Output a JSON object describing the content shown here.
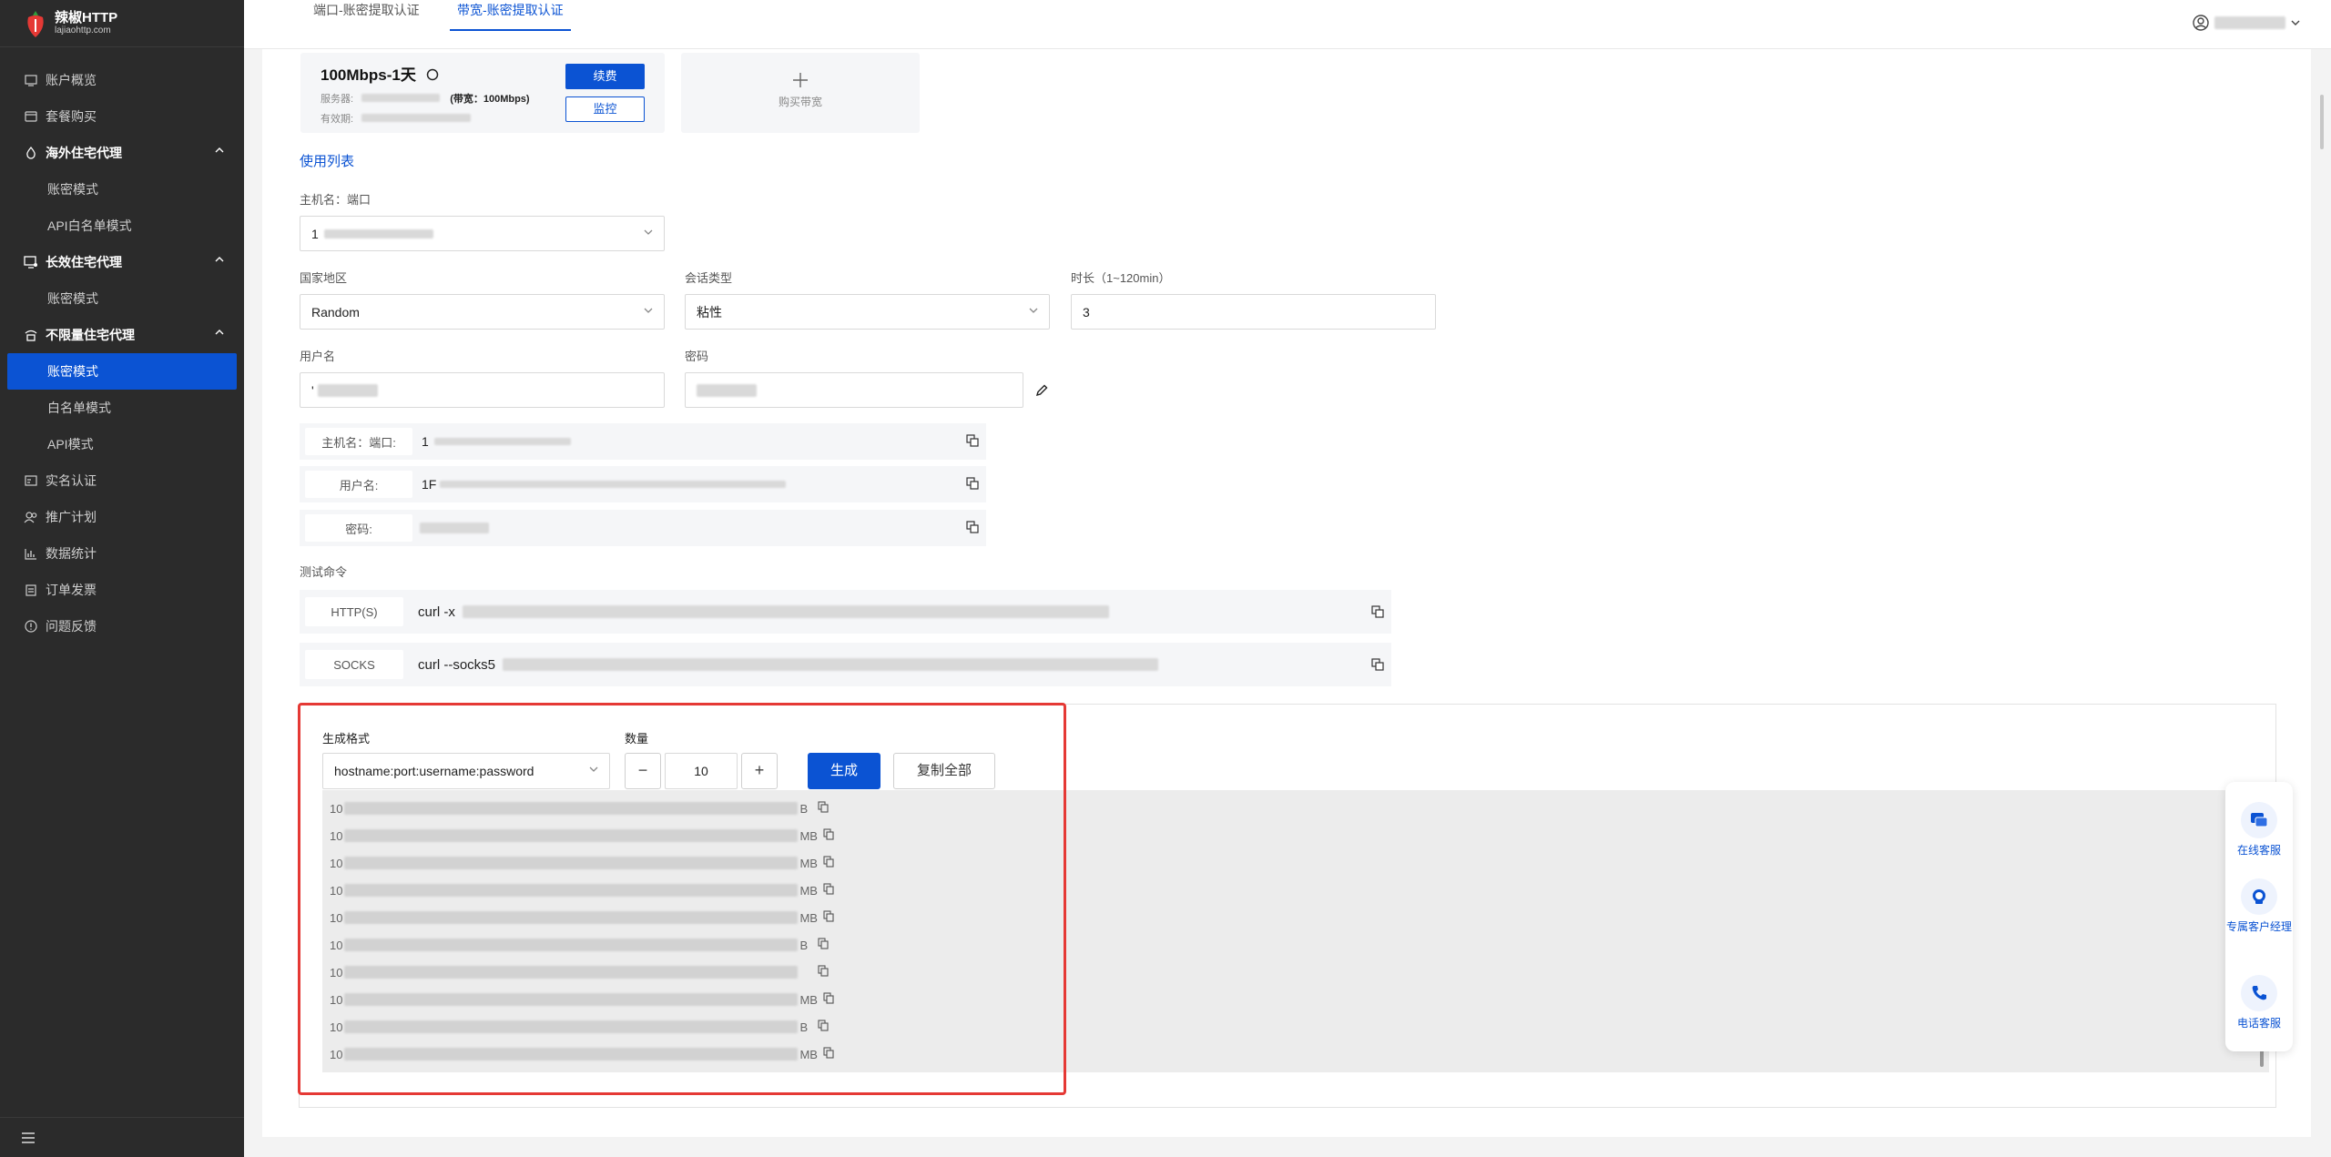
{
  "brand": {
    "name": "辣椒HTTP",
    "domain": "lajiaohttp.com"
  },
  "sidebar": {
    "items": [
      {
        "label": "账户概览",
        "type": "item",
        "icon": "monitor-icon"
      },
      {
        "label": "套餐购买",
        "type": "item",
        "icon": "wallet-icon"
      },
      {
        "label": "海外住宅代理",
        "type": "group",
        "icon": "drop-icon"
      },
      {
        "label": "账密模式",
        "type": "sub"
      },
      {
        "label": "API白名单模式",
        "type": "sub"
      },
      {
        "label": "长效住宅代理",
        "type": "group",
        "icon": "desktop-icon"
      },
      {
        "label": "账密模式",
        "type": "sub"
      },
      {
        "label": "不限量住宅代理",
        "type": "group",
        "icon": "signal-home-icon"
      },
      {
        "label": "账密模式",
        "type": "sub",
        "active": true
      },
      {
        "label": "白名单模式",
        "type": "sub"
      },
      {
        "label": "API模式",
        "type": "sub"
      },
      {
        "label": "实名认证",
        "type": "item",
        "icon": "id-card-icon"
      },
      {
        "label": "推广计划",
        "type": "item",
        "icon": "people-icon"
      },
      {
        "label": "数据统计",
        "type": "item",
        "icon": "bar-chart-icon"
      },
      {
        "label": "订单发票",
        "type": "item",
        "icon": "clipboard-icon"
      },
      {
        "label": "问题反馈",
        "type": "item",
        "icon": "alert-circle-icon"
      }
    ]
  },
  "tabs": [
    {
      "label": "端口-账密提取认证",
      "active": false
    },
    {
      "label": "带宽-账密提取认证",
      "active": true
    }
  ],
  "order": {
    "title": "100Mbps-1天",
    "server_label": "服务器:",
    "bandwidth_text": "(带宽：100Mbps)",
    "expiry_label": "有效期:",
    "renew_label": "续费",
    "monitor_label": "监控",
    "buy_label": "购买带宽"
  },
  "usage_list_title": "使用列表",
  "form": {
    "host_port_label": "主机名：端口",
    "host_port_value": "1",
    "country_label": "国家地区",
    "country_value": "Random",
    "session_label": "会话类型",
    "session_value": "粘性",
    "duration_label": "时长（1~120min）",
    "duration_value": "3",
    "username_label": "用户名",
    "username_value": "'",
    "password_label": "密码"
  },
  "info": {
    "host_key": "主机名：端口:",
    "host_value": "1",
    "user_key": "用户名:",
    "user_value": "1F",
    "pass_key": "密码:"
  },
  "test_cmd": {
    "title": "测试命令",
    "http_key": "HTTP(S)",
    "http_value": "curl -x",
    "socks_key": "SOCKS",
    "socks_value": "curl --socks5"
  },
  "generator": {
    "format_label": "生成格式",
    "format_value": "hostname:port:username:password",
    "qty_label": "数量",
    "qty_value": "10",
    "minus": "−",
    "plus": "+",
    "generate_label": "生成",
    "copy_all_label": "复制全部",
    "results": [
      {
        "prefix": "10",
        "suffix": "B"
      },
      {
        "prefix": "10",
        "suffix": "MB"
      },
      {
        "prefix": "10",
        "suffix": "MB"
      },
      {
        "prefix": "10",
        "suffix": "MB"
      },
      {
        "prefix": "10",
        "suffix": "MB"
      },
      {
        "prefix": "10",
        "suffix": "B"
      },
      {
        "prefix": "10",
        "suffix": ""
      },
      {
        "prefix": "10",
        "suffix": "MB"
      },
      {
        "prefix": "10",
        "suffix": "B"
      },
      {
        "prefix": "10",
        "suffix": "MB"
      }
    ]
  },
  "service": {
    "online": "在线客服",
    "manager": "专属客户经理",
    "phone": "电话客服"
  },
  "colors": {
    "accent": "#0b53d3",
    "sidebar": "#2b2b2b",
    "highlight": "#e53935"
  }
}
